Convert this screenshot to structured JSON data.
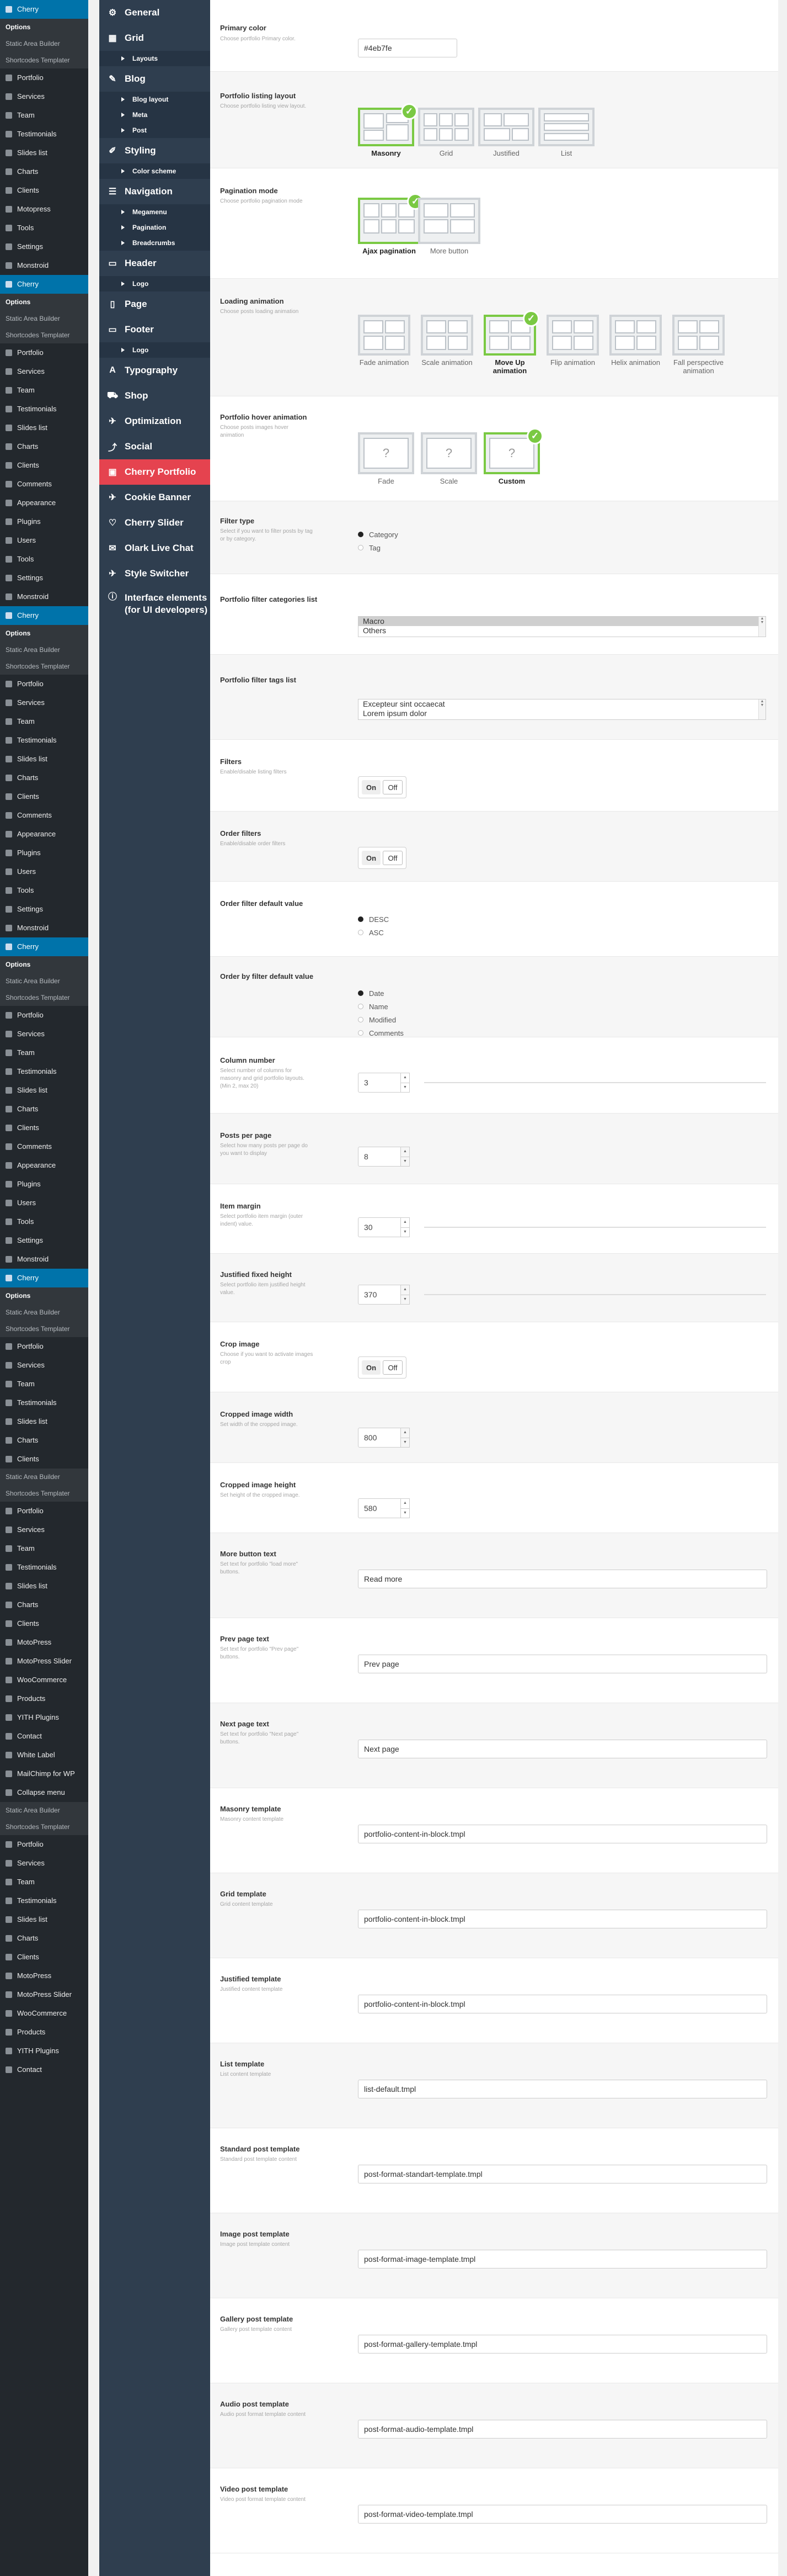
{
  "wp_menu": [
    {
      "label": "Cherry",
      "type": "active"
    },
    {
      "label": "Options",
      "type": "sub",
      "current": true
    },
    {
      "label": "Static Area Builder",
      "type": "sub"
    },
    {
      "label": "Shortcodes Templater",
      "type": "sub"
    },
    {
      "label": "Portfolio",
      "type": "item"
    },
    {
      "label": "Services",
      "type": "item"
    },
    {
      "label": "Team",
      "type": "item"
    },
    {
      "label": "Testimonials",
      "type": "item"
    },
    {
      "label": "Slides list",
      "type": "item"
    },
    {
      "label": "Charts",
      "type": "item"
    },
    {
      "label": "Clients",
      "type": "item"
    },
    {
      "label": "Motopress",
      "type": "item"
    },
    {
      "label": "Tools",
      "type": "item"
    },
    {
      "label": "Settings",
      "type": "item"
    },
    {
      "label": "Monstroid",
      "type": "item"
    },
    {
      "label": "Cherry",
      "type": "active"
    },
    {
      "label": "Options",
      "type": "sub",
      "current": true
    },
    {
      "label": "Static Area Builder",
      "type": "sub"
    },
    {
      "label": "Shortcodes Templater",
      "type": "sub"
    },
    {
      "label": "Portfolio",
      "type": "item"
    },
    {
      "label": "Services",
      "type": "item"
    },
    {
      "label": "Team",
      "type": "item"
    },
    {
      "label": "Testimonials",
      "type": "item"
    },
    {
      "label": "Slides list",
      "type": "item"
    },
    {
      "label": "Charts",
      "type": "item"
    },
    {
      "label": "Clients",
      "type": "item"
    },
    {
      "label": "Comments",
      "type": "item"
    },
    {
      "label": "Appearance",
      "type": "item"
    },
    {
      "label": "Plugins",
      "type": "item"
    },
    {
      "label": "Users",
      "type": "item"
    },
    {
      "label": "Tools",
      "type": "item"
    },
    {
      "label": "Settings",
      "type": "item"
    },
    {
      "label": "Monstroid",
      "type": "item"
    },
    {
      "label": "Cherry",
      "type": "active"
    },
    {
      "label": "Options",
      "type": "sub",
      "current": true
    },
    {
      "label": "Static Area Builder",
      "type": "sub"
    },
    {
      "label": "Shortcodes Templater",
      "type": "sub"
    },
    {
      "label": "Portfolio",
      "type": "item"
    },
    {
      "label": "Services",
      "type": "item"
    },
    {
      "label": "Team",
      "type": "item"
    },
    {
      "label": "Testimonials",
      "type": "item"
    },
    {
      "label": "Slides list",
      "type": "item"
    },
    {
      "label": "Charts",
      "type": "item"
    },
    {
      "label": "Clients",
      "type": "item"
    },
    {
      "label": "Comments",
      "type": "item"
    },
    {
      "label": "Appearance",
      "type": "item"
    },
    {
      "label": "Plugins",
      "type": "item"
    },
    {
      "label": "Users",
      "type": "item"
    },
    {
      "label": "Tools",
      "type": "item"
    },
    {
      "label": "Settings",
      "type": "item"
    },
    {
      "label": "Monstroid",
      "type": "item"
    },
    {
      "label": "Cherry",
      "type": "active"
    },
    {
      "label": "Options",
      "type": "sub",
      "current": true
    },
    {
      "label": "Static Area Builder",
      "type": "sub"
    },
    {
      "label": "Shortcodes Templater",
      "type": "sub"
    },
    {
      "label": "Portfolio",
      "type": "item"
    },
    {
      "label": "Services",
      "type": "item"
    },
    {
      "label": "Team",
      "type": "item"
    },
    {
      "label": "Testimonials",
      "type": "item"
    },
    {
      "label": "Slides list",
      "type": "item"
    },
    {
      "label": "Charts",
      "type": "item"
    },
    {
      "label": "Clients",
      "type": "item"
    },
    {
      "label": "Comments",
      "type": "item"
    },
    {
      "label": "Appearance",
      "type": "item"
    },
    {
      "label": "Plugins",
      "type": "item"
    },
    {
      "label": "Users",
      "type": "item"
    },
    {
      "label": "Tools",
      "type": "item"
    },
    {
      "label": "Settings",
      "type": "item"
    },
    {
      "label": "Monstroid",
      "type": "item"
    },
    {
      "label": "Cherry",
      "type": "active"
    },
    {
      "label": "Options",
      "type": "sub",
      "current": true
    },
    {
      "label": "Static Area Builder",
      "type": "sub"
    },
    {
      "label": "Shortcodes Templater",
      "type": "sub"
    },
    {
      "label": "Portfolio",
      "type": "item"
    },
    {
      "label": "Services",
      "type": "item"
    },
    {
      "label": "Team",
      "type": "item"
    },
    {
      "label": "Testimonials",
      "type": "item"
    },
    {
      "label": "Slides list",
      "type": "item"
    },
    {
      "label": "Charts",
      "type": "item"
    },
    {
      "label": "Clients",
      "type": "item"
    },
    {
      "label": "Static Area Builder",
      "type": "sub"
    },
    {
      "label": "Shortcodes Templater",
      "type": "sub"
    },
    {
      "label": "Portfolio",
      "type": "item"
    },
    {
      "label": "Services",
      "type": "item"
    },
    {
      "label": "Team",
      "type": "item"
    },
    {
      "label": "Testimonials",
      "type": "item"
    },
    {
      "label": "Slides list",
      "type": "item"
    },
    {
      "label": "Charts",
      "type": "item"
    },
    {
      "label": "Clients",
      "type": "item"
    },
    {
      "label": "MotoPress",
      "type": "item"
    },
    {
      "label": "MotoPress Slider",
      "type": "item"
    },
    {
      "label": "WooCommerce",
      "type": "item"
    },
    {
      "label": "Products",
      "type": "item"
    },
    {
      "label": "YITH Plugins",
      "type": "item"
    },
    {
      "label": "Contact",
      "type": "item"
    },
    {
      "label": "White Label",
      "type": "item"
    },
    {
      "label": "MailChimp for WP",
      "type": "item"
    },
    {
      "label": "Collapse menu",
      "type": "item"
    },
    {
      "label": "Static Area Builder",
      "type": "sub"
    },
    {
      "label": "Shortcodes Templater",
      "type": "sub"
    },
    {
      "label": "Portfolio",
      "type": "item"
    },
    {
      "label": "Services",
      "type": "item"
    },
    {
      "label": "Team",
      "type": "item"
    },
    {
      "label": "Testimonials",
      "type": "item"
    },
    {
      "label": "Slides list",
      "type": "item"
    },
    {
      "label": "Charts",
      "type": "item"
    },
    {
      "label": "Clients",
      "type": "item"
    },
    {
      "label": "MotoPress",
      "type": "item"
    },
    {
      "label": "MotoPress Slider",
      "type": "item"
    },
    {
      "label": "WooCommerce",
      "type": "item"
    },
    {
      "label": "Products",
      "type": "item"
    },
    {
      "label": "YITH Plugins",
      "type": "item"
    },
    {
      "label": "Contact",
      "type": "item"
    }
  ],
  "cherry_nav": [
    {
      "label": "General",
      "icon": "gear-icon",
      "glyph": "⚙"
    },
    {
      "label": "Grid",
      "icon": "grid-icon",
      "glyph": "▦"
    },
    {
      "label": "Layouts",
      "sub": true
    },
    {
      "label": "Blog",
      "icon": "pin-icon",
      "glyph": "✎"
    },
    {
      "label": "Blog layout",
      "sub": true
    },
    {
      "label": "Meta",
      "sub": true
    },
    {
      "label": "Post",
      "sub": true
    },
    {
      "label": "Styling",
      "icon": "brush-icon",
      "glyph": "✐"
    },
    {
      "label": "Color scheme",
      "sub": true
    },
    {
      "label": "Navigation",
      "icon": "navigation-icon",
      "glyph": "☰"
    },
    {
      "label": "Megamenu",
      "sub": true
    },
    {
      "label": "Pagination",
      "sub": true
    },
    {
      "label": "Breadcrumbs",
      "sub": true
    },
    {
      "label": "Header",
      "icon": "header-icon",
      "glyph": "▭"
    },
    {
      "label": "Logo",
      "sub": true
    },
    {
      "label": "Page",
      "icon": "page-icon",
      "glyph": "▯"
    },
    {
      "label": "Footer",
      "icon": "footer-icon",
      "glyph": "▭"
    },
    {
      "label": "Logo",
      "sub": true
    },
    {
      "label": "Typography",
      "icon": "typography-icon",
      "glyph": "A"
    },
    {
      "label": "Shop",
      "icon": "cart-icon",
      "glyph": "⛟"
    },
    {
      "label": "Optimization",
      "icon": "wrench-icon",
      "glyph": "✈"
    },
    {
      "label": "Social",
      "icon": "share-icon",
      "glyph": "⤴"
    },
    {
      "label": "Cherry Portfolio",
      "icon": "portfolio-icon",
      "glyph": "▣",
      "active": true
    },
    {
      "label": "Cookie Banner",
      "icon": "wrench-icon",
      "glyph": "✈"
    },
    {
      "label": "Cherry Slider",
      "icon": "heart-icon",
      "glyph": "♡"
    },
    {
      "label": "Olark Live Chat",
      "icon": "chat-icon",
      "glyph": "✉"
    },
    {
      "label": "Style Switcher",
      "icon": "wrench-icon",
      "glyph": "✈"
    },
    {
      "label": "Interface elements (for UI developers)",
      "icon": "info-icon",
      "glyph": "ⓘ",
      "tall": true
    }
  ],
  "options": {
    "primary_color": {
      "title": "Primary color",
      "desc": "Choose portfolio Primary color.",
      "value": "#4eb7fe"
    },
    "listing_layout": {
      "title": "Portfolio listing layout",
      "desc": "Choose portfolio listing view layout.",
      "items": [
        "Masonry",
        "Grid",
        "Justified",
        "List"
      ],
      "selected": "Masonry"
    },
    "pagination_mode": {
      "title": "Pagination mode",
      "desc": "Choose portfolio pagination mode",
      "items": [
        "Ajax pagination",
        "More button"
      ],
      "selected": "Ajax pagination"
    },
    "loading_animation": {
      "title": "Loading animation",
      "desc": "Choose posts loading animation",
      "items": [
        "Fade animation",
        "Scale animation",
        "Move Up animation",
        "Flip animation",
        "Helix animation",
        "Fall perspective animation"
      ],
      "selected": "Move Up animation"
    },
    "hover_animation": {
      "title": "Portfolio hover animation",
      "desc": "Choose posts images hover animation",
      "items": [
        "Fade",
        "Scale",
        "Custom"
      ],
      "selected": "Custom"
    },
    "filter_type": {
      "title": "Filter type",
      "desc": "Select if you want to filter posts by tag or by category.",
      "items": [
        "Category",
        "Tag"
      ],
      "selected": "Category"
    },
    "filter_categories": {
      "title": "Portfolio filter categories list",
      "items": [
        "Macro",
        "Others"
      ]
    },
    "filter_tags": {
      "title": "Portfolio filter tags list",
      "items": [
        "Excepteur sint occaecat",
        "Lorem ipsum dolor"
      ]
    },
    "filters": {
      "title": "Filters",
      "desc": "Enable/disable listing filters",
      "on": "On",
      "off": "Off"
    },
    "order_filters": {
      "title": "Order filters",
      "desc": "Enable/disable order filters",
      "on": "On",
      "off": "Off"
    },
    "order_default": {
      "title": "Order filter default value",
      "items": [
        "DESC",
        "ASC"
      ],
      "selected": "DESC"
    },
    "orderby_default": {
      "title": "Order by filter default value",
      "items": [
        "Date",
        "Name",
        "Modified",
        "Comments"
      ],
      "selected": "Date"
    },
    "column_number": {
      "title": "Column number",
      "desc": "Select number of columns for masonry and grid portfolio layouts. (Min 2, max 20)",
      "value": "3"
    },
    "posts_per_page": {
      "title": "Posts per page",
      "desc": "Select how many posts per page do you want to display",
      "value": "8"
    },
    "item_margin": {
      "title": "Item margin",
      "desc": "Select portfolio item margin (outer indent) value.",
      "value": "30"
    },
    "justified_height": {
      "title": "Justified fixed height",
      "desc": "Select portfolio item justified height value.",
      "value": "370"
    },
    "crop_image": {
      "title": "Crop image",
      "desc": "Choose if you want to activate images crop",
      "on": "On",
      "off": "Off"
    },
    "crop_width": {
      "title": "Cropped image width",
      "desc": "Set width of the cropped image.",
      "value": "800"
    },
    "crop_height": {
      "title": "Cropped image height",
      "desc": "Set height of the cropped image.",
      "value": "580"
    },
    "more_button": {
      "title": "More button text",
      "desc": "Set text for portfolio \"load more\" buttons.",
      "value": "Read more"
    },
    "prev_page": {
      "title": "Prev page text",
      "desc": "Set text for portfolio \"Prev page\" buttons.",
      "value": "Prev page"
    },
    "next_page": {
      "title": "Next page text",
      "desc": "Set text for portfolio \"Next page\" buttons.",
      "value": "Next page"
    },
    "masonry_template": {
      "title": "Masonry template",
      "desc": "Masonry content template",
      "value": "portfolio-content-in-block.tmpl"
    },
    "grid_template": {
      "title": "Grid template",
      "desc": "Grid content template",
      "value": "portfolio-content-in-block.tmpl"
    },
    "justified_template": {
      "title": "Justified template",
      "desc": "Justified content template",
      "value": "portfolio-content-in-block.tmpl"
    },
    "list_template": {
      "title": "List template",
      "desc": "List content template",
      "value": "list-default.tmpl"
    },
    "standard_template": {
      "title": "Standard post template",
      "desc": "Standard post template content",
      "value": "post-format-standart-template.tmpl"
    },
    "image_template": {
      "title": "Image post template",
      "desc": "Image post template content",
      "value": "post-format-image-template.tmpl"
    },
    "gallery_template": {
      "title": "Gallery post template",
      "desc": "Gallery post template content",
      "value": "post-format-gallery-template.tmpl"
    },
    "audio_template": {
      "title": "Audio post template",
      "desc": "Audio post format template content",
      "value": "post-format-audio-template.tmpl"
    },
    "video_template": {
      "title": "Video post template",
      "desc": "Video post format template content",
      "value": "post-format-video-template.tmpl"
    }
  },
  "colors": {
    "accent": "#e5434f",
    "selected": "#7ac943",
    "wp_active": "#0073aa",
    "nav_bg": "#2f3e4f",
    "wp_bg": "#23282d"
  }
}
